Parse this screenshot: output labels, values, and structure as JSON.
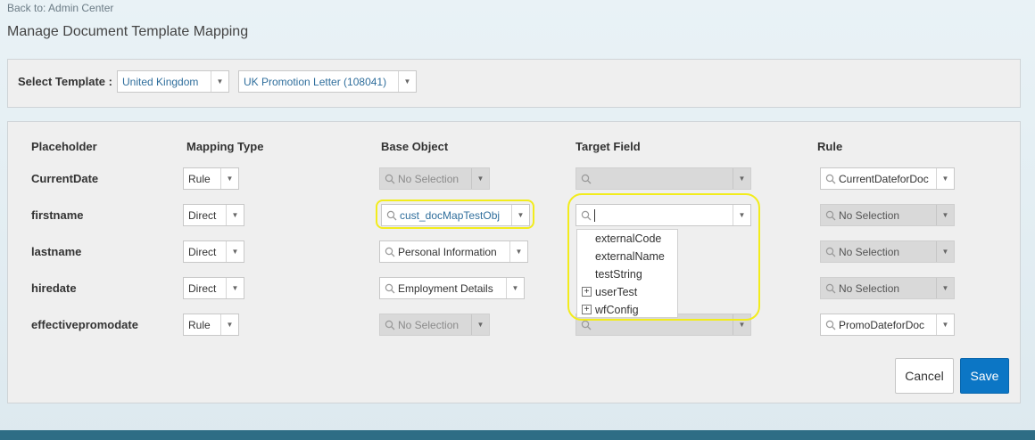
{
  "header": {
    "back_link": "Back to: Admin Center",
    "title": "Manage Document Template Mapping"
  },
  "template_select": {
    "label": "Select Template :",
    "country": "United Kingdom",
    "template": "UK Promotion Letter (108041)"
  },
  "mapping": {
    "columns": [
      "Placeholder",
      "Mapping Type",
      "Base Object",
      "Target Field",
      "Rule"
    ],
    "rows": [
      {
        "placeholder": "CurrentDate",
        "mapping_type": "Rule",
        "base_object": "No Selection",
        "target_field": "",
        "rule": "CurrentDateforDoc"
      },
      {
        "placeholder": "firstname",
        "mapping_type": "Direct",
        "base_object": "cust_docMapTestObj",
        "target_field": "",
        "rule": "No Selection"
      },
      {
        "placeholder": "lastname",
        "mapping_type": "Direct",
        "base_object": "Personal Information",
        "target_field": "",
        "rule": "No Selection"
      },
      {
        "placeholder": "hiredate",
        "mapping_type": "Direct",
        "base_object": "Employment Details",
        "target_field": "",
        "rule": "No Selection"
      },
      {
        "placeholder": "effectivepromodate",
        "mapping_type": "Rule",
        "base_object": "No Selection",
        "target_field": "",
        "rule": "PromoDateforDoc"
      }
    ]
  },
  "target_dropdown": {
    "options": [
      {
        "label": "externalCode",
        "expandable": false
      },
      {
        "label": "externalName",
        "expandable": false
      },
      {
        "label": "testString",
        "expandable": false
      },
      {
        "label": "userTest",
        "expandable": true
      },
      {
        "label": "wfConfig",
        "expandable": true
      }
    ]
  },
  "actions": {
    "cancel": "Cancel",
    "save": "Save"
  },
  "colors": {
    "accent": "#0c76c5",
    "highlight": "#f2ec1c",
    "link": "#2f6e9c",
    "footer": "#2e6d85"
  }
}
